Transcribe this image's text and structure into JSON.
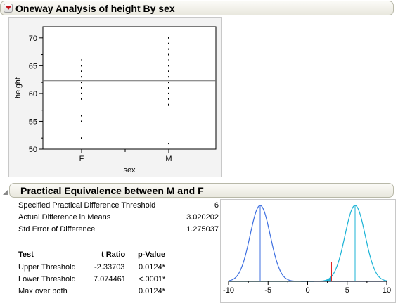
{
  "oneway": {
    "title": "Oneway Analysis of height By sex",
    "plot": {
      "ylabel": "height",
      "xlabel": "sex",
      "yticks": [
        "70",
        "65",
        "60",
        "55",
        "50"
      ],
      "categories": [
        "F",
        "M"
      ]
    }
  },
  "equiv": {
    "title": "Practical Equivalence between M and F",
    "stats": [
      {
        "label": "Specified Practical Difference Threshold",
        "value": "6"
      },
      {
        "label": "Actual Difference in Means",
        "value": "3.020202"
      },
      {
        "label": "Std Error of Difference",
        "value": "1.275037"
      }
    ],
    "table": {
      "headers": [
        "Test",
        "t Ratio",
        "p-Value"
      ],
      "rows": [
        {
          "test": "Upper Threshold",
          "t": "-2.33703",
          "p": "0.0124*"
        },
        {
          "test": "Lower Threshold",
          "t": "7.074461",
          "p": "<.0001*"
        },
        {
          "test": "Max over both",
          "t": "",
          "p": "0.0124*"
        }
      ]
    },
    "density_ticks": [
      "-10",
      "-5",
      "0",
      "5",
      "10"
    ]
  },
  "chart_data": [
    {
      "type": "scatter",
      "xlabel": "sex",
      "ylabel": "height",
      "categories": [
        "F",
        "M"
      ],
      "ylim": [
        50,
        72
      ],
      "series": [
        {
          "category": "F",
          "values": [
            52,
            55,
            56,
            59,
            60,
            61,
            62,
            63,
            64,
            65,
            66
          ]
        },
        {
          "category": "M",
          "values": [
            51,
            58,
            59,
            60,
            61,
            62,
            63,
            64,
            65,
            66,
            67,
            68,
            69,
            70
          ]
        }
      ],
      "reference_line": 62.3
    },
    {
      "type": "line",
      "xlim": [
        -10,
        10
      ],
      "xticks": [
        -10,
        -5,
        0,
        5,
        10
      ],
      "curves": [
        {
          "center": -6,
          "color": "#3d6fe0"
        },
        {
          "center": 6,
          "color": "#1bb3d6"
        }
      ],
      "observed_difference": 3.020202,
      "marker_color": "#e02020"
    }
  ]
}
